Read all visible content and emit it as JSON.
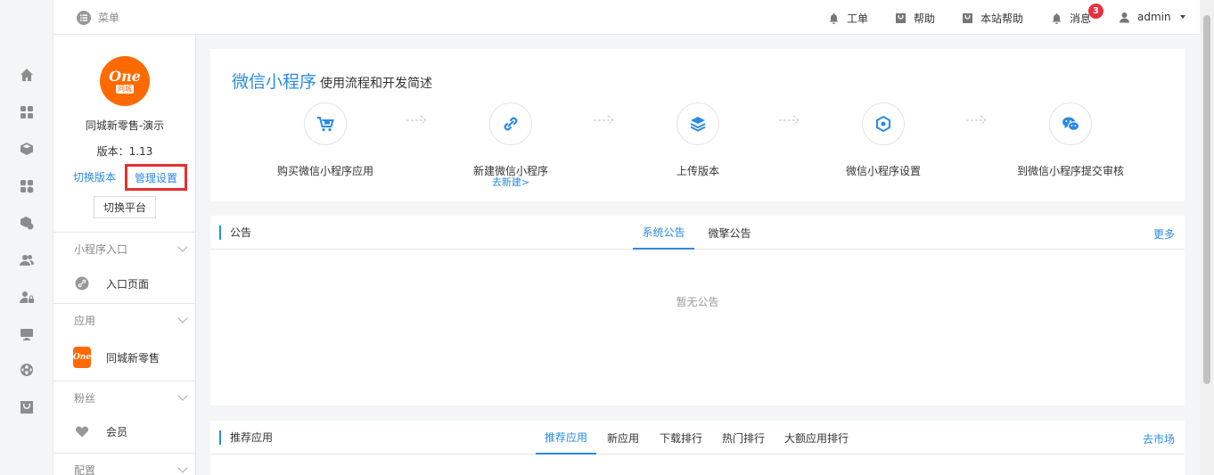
{
  "topbar": {
    "menu_label": "菜单",
    "items": [
      {
        "label": "工单",
        "icon": "bell-icon"
      },
      {
        "label": "帮助",
        "icon": "bag-icon"
      },
      {
        "label": "本站帮助",
        "icon": "bag-icon"
      },
      {
        "label": "消息",
        "icon": "bell-icon",
        "badge": "3"
      }
    ],
    "user": "admin"
  },
  "rail": [
    "home-icon",
    "apps-icon",
    "cube-icon",
    "plugins-icon",
    "package-icon",
    "users-icon",
    "user-lock-icon",
    "monitor-icon",
    "globe-icon",
    "store-icon"
  ],
  "sidebar": {
    "logo_text": "One",
    "logo_sub": "同城",
    "shop_name": "同城新零售-演示",
    "version": "版本：1.13",
    "switch_version": "切换版本",
    "manage_settings": "管理设置",
    "switch_platform": "切换平台",
    "sections": [
      {
        "title": "小程序入口",
        "items": [
          {
            "label": "入口页面",
            "icon": "link-icon"
          }
        ]
      },
      {
        "title": "应用",
        "items": [
          {
            "label": "同城新零售",
            "icon": "app-logo-icon"
          }
        ]
      },
      {
        "title": "粉丝",
        "items": [
          {
            "label": "会员",
            "icon": "heart-icon"
          }
        ]
      },
      {
        "title": "配置",
        "items": []
      }
    ]
  },
  "guide": {
    "title": "微信小程序",
    "subtitle": "使用流程和开发简述",
    "steps": [
      {
        "label": "购买微信小程序应用",
        "icon": "cart-icon",
        "sub": ""
      },
      {
        "label": "新建微信小程序",
        "icon": "link-icon",
        "sub": "去新建>"
      },
      {
        "label": "上传版本",
        "icon": "layers-icon",
        "sub": ""
      },
      {
        "label": "微信小程序设置",
        "icon": "hexagon-icon",
        "sub": ""
      },
      {
        "label": "到微信小程序提交审核",
        "icon": "wechat-icon",
        "sub": ""
      }
    ]
  },
  "notice": {
    "title": "公告",
    "tabs": [
      "系统公告",
      "微擎公告"
    ],
    "active_tab": 0,
    "more": "更多",
    "empty": "暂无公告"
  },
  "recommend": {
    "title": "推荐应用",
    "tabs": [
      "推荐应用",
      "新应用",
      "下载排行",
      "热门排行",
      "大额应用排行"
    ],
    "active_tab": 0,
    "more": "去市场"
  },
  "colors": {
    "accent": "#2a8ae4",
    "brand": "#ff6a00",
    "highlight": "#e52f2f",
    "badge": "#e8303f"
  }
}
